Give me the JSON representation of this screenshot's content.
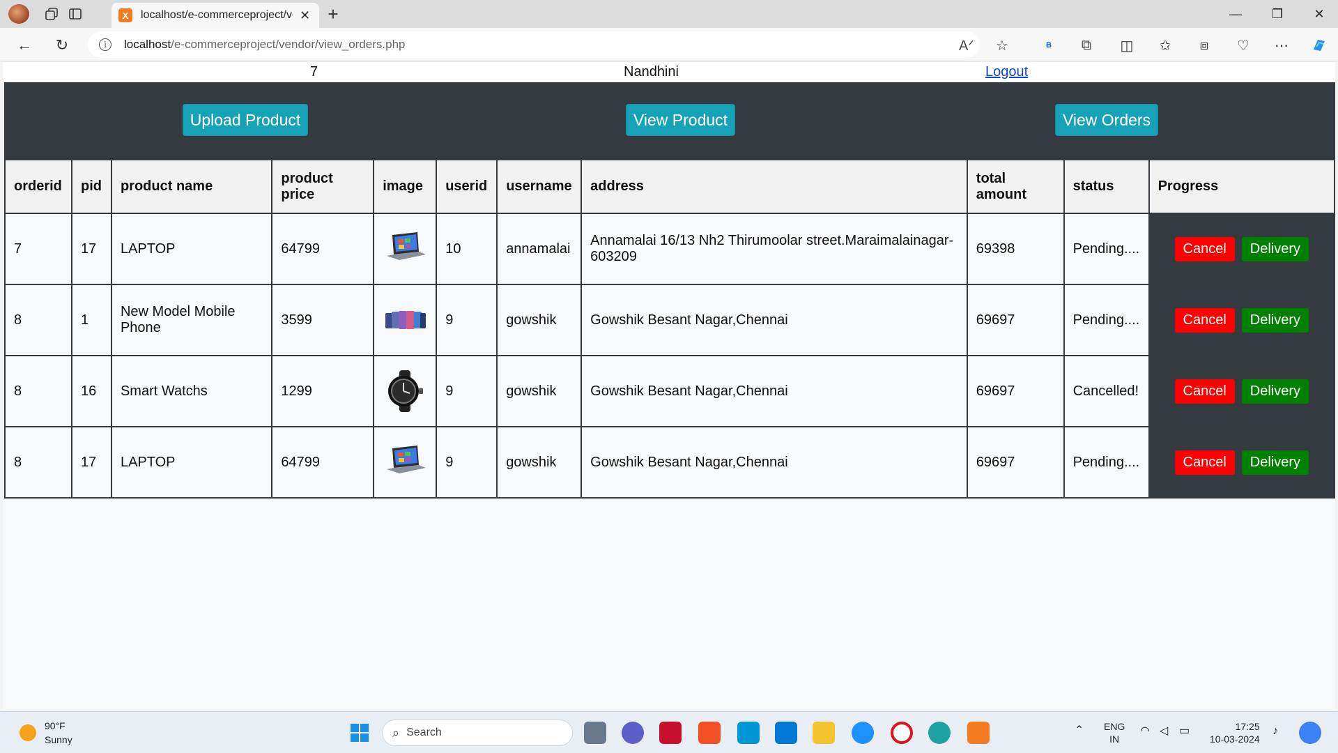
{
  "browser": {
    "tab_title": "localhost/e-commerceproject/ve",
    "tab_favicon": "X",
    "url_host": "localhost",
    "url_path": "/e-commerceproject/vendor/view_orders.php",
    "ext_badge": "B"
  },
  "header": {
    "vendor_id": "7",
    "vendor_name": "Nandhini",
    "logout": "Logout"
  },
  "nav": {
    "upload": "Upload Product",
    "view_product": "View Product",
    "view_orders": "View Orders"
  },
  "table": {
    "headers": [
      "orderid",
      "pid",
      "product name",
      "product price",
      "image",
      "userid",
      "username",
      "address",
      "total amount",
      "status",
      "Progress"
    ],
    "rows": [
      {
        "orderid": "7",
        "pid": "17",
        "product_name": "LAPTOP",
        "price": "64799",
        "image": "laptop",
        "userid": "10",
        "username": "annamalai",
        "address": "Annamalai 16/13 Nh2 Thirumoolar street.Maraimalainagar-603209",
        "total": "69398",
        "status": "Pending...."
      },
      {
        "orderid": "8",
        "pid": "1",
        "product_name": "New Model Mobile Phone",
        "price": "3599",
        "image": "phones",
        "userid": "9",
        "username": "gowshik",
        "address": "Gowshik Besant Nagar,Chennai",
        "total": "69697",
        "status": "Pending...."
      },
      {
        "orderid": "8",
        "pid": "16",
        "product_name": "Smart Watchs",
        "price": "1299",
        "image": "watch",
        "userid": "9",
        "username": "gowshik",
        "address": "Gowshik Besant Nagar,Chennai",
        "total": "69697",
        "status": "Cancelled!"
      },
      {
        "orderid": "8",
        "pid": "17",
        "product_name": "LAPTOP",
        "price": "64799",
        "image": "laptop",
        "userid": "9",
        "username": "gowshik",
        "address": "Gowshik Besant Nagar,Chennai",
        "total": "69697",
        "status": "Pending...."
      }
    ],
    "cancel_label": "Cancel",
    "delivery_label": "Delivery"
  },
  "taskbar": {
    "temp": "90°F",
    "weather": "Sunny",
    "search_label": "Search",
    "lang1": "ENG",
    "lang2": "IN",
    "time": "17:25",
    "date": "10-03-2024"
  },
  "colors": {
    "panel": "#343a40",
    "nav_button": "#17a2b8",
    "cancel": "#ff0000",
    "delivery": "#008000",
    "link": "#0d47d8"
  }
}
